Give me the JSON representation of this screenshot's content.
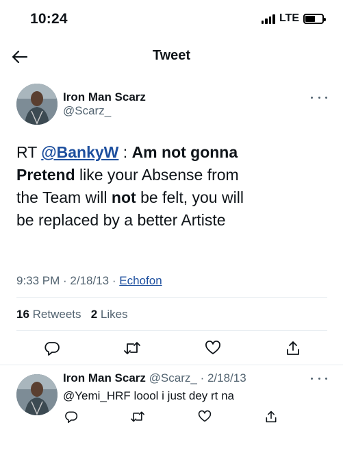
{
  "status_bar": {
    "time": "10:24",
    "network": "LTE",
    "battery_level": 0.6
  },
  "nav": {
    "title": "Tweet"
  },
  "tweet": {
    "author_name": "Iron Man Scarz",
    "author_handle": "@Scarz_",
    "text": {
      "prefix": "RT ",
      "mention": "@BankyW",
      "part1": " : ",
      "bold1": "Am not gonna Pretend",
      "part2": " like your Absense from the Team will ",
      "bold2": "not",
      "part3": " be felt, you will be replaced by a better Artiste"
    },
    "time": "9:33 PM",
    "separator": " · ",
    "date": "2/18/13",
    "source": "Echofon",
    "retweets_count": "16",
    "retweets_label": "Retweets",
    "likes_count": "2",
    "likes_label": "Likes"
  },
  "reply": {
    "author_name": "Iron Man Scarz",
    "author_handle": "@Scarz_",
    "date": "· 2/18/13",
    "text": "@Yemi_HRF loool i just dey rt na"
  },
  "icons": {
    "back": "arrow-left-icon",
    "more": "more-horizontal-icon",
    "reply": "reply-icon",
    "retweet": "retweet-icon",
    "like": "heart-icon",
    "share": "share-icon"
  },
  "colors": {
    "link": "#1d4f9e",
    "secondary_text": "#536471",
    "divider": "#e6ecf0"
  }
}
